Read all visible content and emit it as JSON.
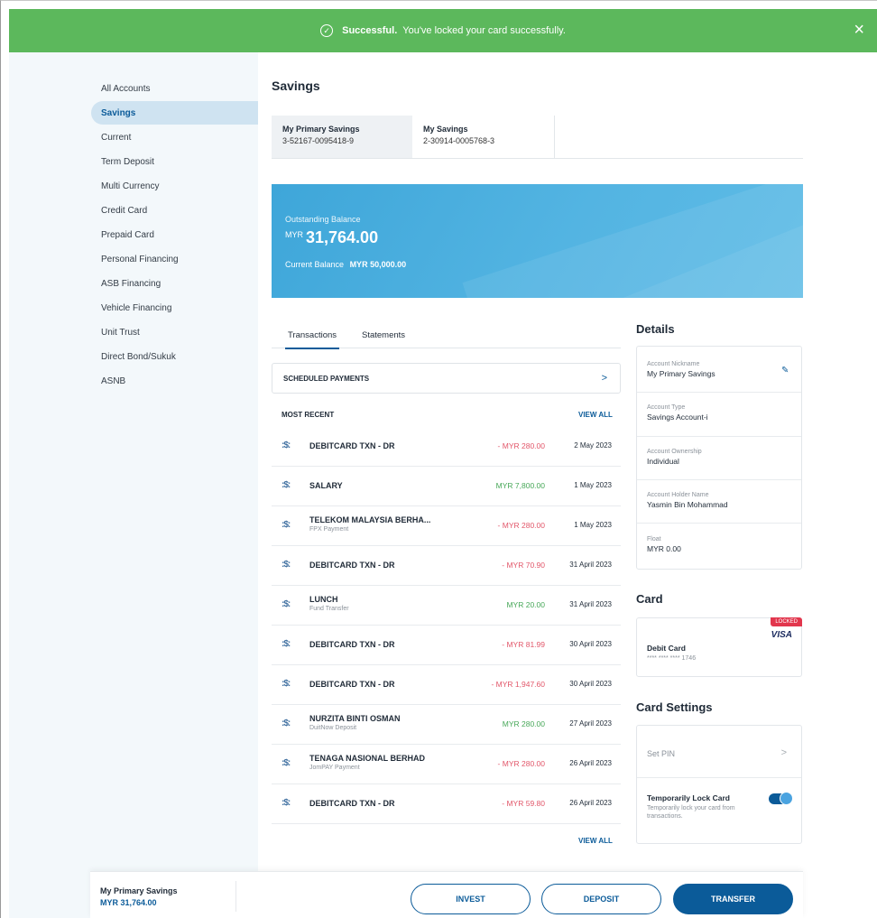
{
  "banner": {
    "title": "Successful.",
    "message": "You've locked your card successfully.",
    "close": "×"
  },
  "sidebar": {
    "items": [
      {
        "label": "All Accounts"
      },
      {
        "label": "Savings"
      },
      {
        "label": "Current"
      },
      {
        "label": "Term Deposit"
      },
      {
        "label": "Multi Currency"
      },
      {
        "label": "Credit Card"
      },
      {
        "label": "Prepaid Card"
      },
      {
        "label": "Personal Financing"
      },
      {
        "label": "ASB Financing"
      },
      {
        "label": "Vehicle Financing"
      },
      {
        "label": "Unit Trust"
      },
      {
        "label": "Direct Bond/Sukuk"
      },
      {
        "label": "ASNB"
      }
    ],
    "active_index": 1
  },
  "main": {
    "title": "Savings",
    "accounts": [
      {
        "name": "My Primary Savings",
        "number": "3-52167-0095418-9"
      },
      {
        "name": "My Savings",
        "number": "2-30914-0005768-3"
      }
    ],
    "balance": {
      "outstanding_label": "Outstanding Balance",
      "currency": "MYR",
      "outstanding": "31,764.00",
      "current_label": "Current Balance",
      "current": "MYR 50,000.00"
    },
    "tabs": {
      "transactions": "Transactions",
      "statements": "Statements"
    },
    "scheduled": "SCHEDULED PAYMENTS",
    "scheduled_chevron": ">",
    "most_recent": "MOST RECENT",
    "view_all": "VIEW ALL",
    "transaction_icon": ":$:",
    "transactions": [
      {
        "name": "DEBITCARD TXN - DR",
        "sub": "",
        "amount": "- MYR 280.00",
        "type": "debit",
        "date": "2 May 2023"
      },
      {
        "name": "SALARY",
        "sub": "",
        "amount": "MYR 7,800.00",
        "type": "credit",
        "date": "1 May 2023"
      },
      {
        "name": "TELEKOM MALAYSIA BERHA...",
        "sub": "FPX Payment",
        "amount": "- MYR 280.00",
        "type": "debit",
        "date": "1 May 2023"
      },
      {
        "name": "DEBITCARD TXN - DR",
        "sub": "",
        "amount": "- MYR 70.90",
        "type": "debit",
        "date": "31 April 2023"
      },
      {
        "name": "LUNCH",
        "sub": "Fund Transfer",
        "amount": "MYR 20.00",
        "type": "credit",
        "date": "31 April 2023"
      },
      {
        "name": "DEBITCARD TXN - DR",
        "sub": "",
        "amount": "- MYR 81.99",
        "type": "debit",
        "date": "30 April 2023"
      },
      {
        "name": "DEBITCARD TXN - DR",
        "sub": "",
        "amount": "- MYR 1,947.60",
        "type": "debit",
        "date": "30 April 2023"
      },
      {
        "name": "NURZITA BINTI OSMAN",
        "sub": "DuitNow Deposit",
        "amount": "MYR 280.00",
        "type": "credit",
        "date": "27 April 2023"
      },
      {
        "name": "TENAGA NASIONAL BERHAD",
        "sub": "JomPAY Payment",
        "amount": "- MYR 280.00",
        "type": "debit",
        "date": "26 April 2023"
      },
      {
        "name": "DEBITCARD TXN - DR",
        "sub": "",
        "amount": "- MYR 59.80",
        "type": "debit",
        "date": "26 April 2023"
      }
    ]
  },
  "details": {
    "title": "Details",
    "fields": [
      {
        "label": "Account Nickname",
        "value": "My Primary Savings"
      },
      {
        "label": "Account Type",
        "value": "Savings Account-i"
      },
      {
        "label": "Account Ownership",
        "value": "Individual"
      },
      {
        "label": "Account Holder Name",
        "value": "Yasmin Bin Mohammad"
      },
      {
        "label": "Float",
        "value": "MYR 0.00"
      }
    ]
  },
  "card": {
    "title": "Card",
    "status": "LOCKED",
    "brand": "VISA",
    "name": "Debit Card",
    "number": "**** **** **** 1746"
  },
  "card_settings": {
    "title": "Card Settings",
    "set_pin": "Set PIN",
    "chevron": ">",
    "lock_title": "Temporarily Lock Card",
    "lock_desc": "Temporarily lock your card from transactions.",
    "lock_enabled": true
  },
  "bottom_bar": {
    "account_name": "My Primary Savings",
    "account_balance": "MYR 31,764.00",
    "invest": "INVEST",
    "deposit": "DEPOSIT",
    "transfer": "TRANSFER"
  },
  "colors": {
    "banner": "#5cb85c",
    "primary": "#0b5b99",
    "debit": "#e2576a",
    "credit": "#48a859",
    "locked": "#e2364d"
  }
}
